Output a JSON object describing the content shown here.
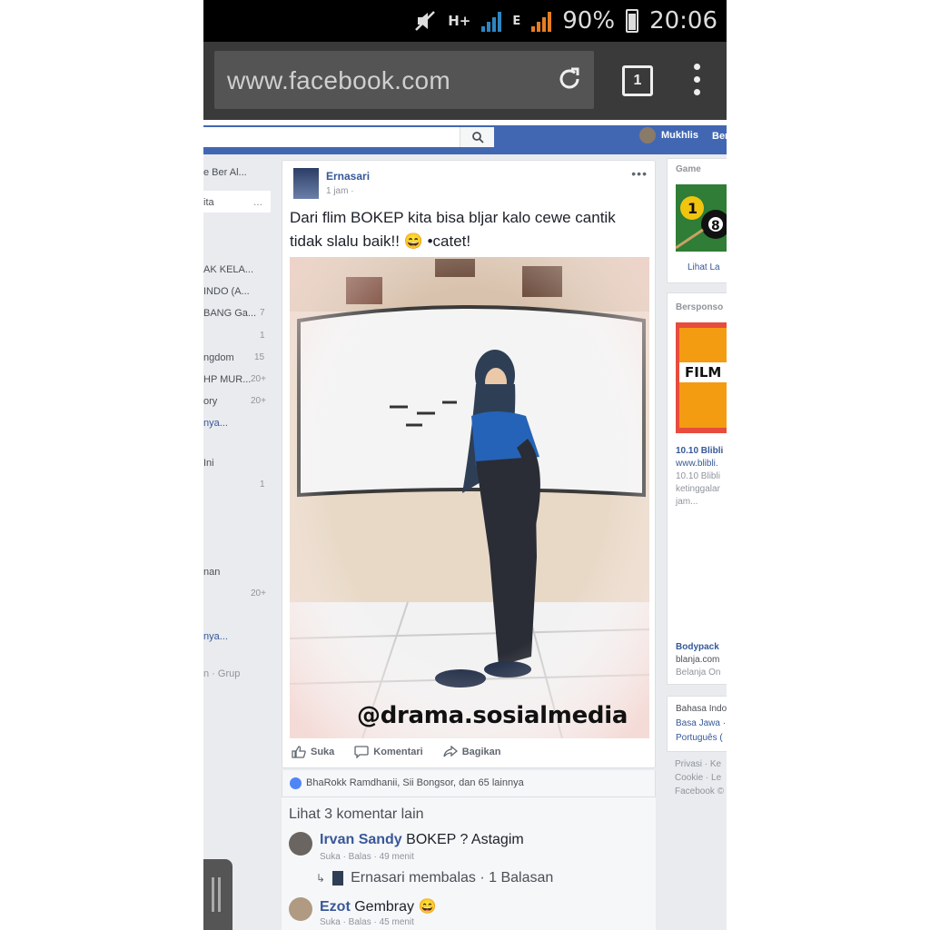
{
  "status_bar": {
    "network_type": "H+",
    "network_type2": "E",
    "battery": "90%",
    "time": "20:06"
  },
  "browser": {
    "url": "www.facebook.com",
    "tab_count": "1"
  },
  "fb_header": {
    "user_name": "Mukhlis",
    "user_extra": "Ber"
  },
  "left_nav": {
    "items": [
      {
        "label": "e Ber Al...",
        "count": ""
      },
      {
        "label": "ita",
        "count": "..."
      },
      {
        "label": "AK KELA...",
        "count": ""
      },
      {
        "label": "INDO (A...",
        "count": ""
      },
      {
        "label": "BANG Ga...",
        "count": "7"
      },
      {
        "label": "",
        "count": "1"
      },
      {
        "label": "ngdom",
        "count": "15"
      },
      {
        "label": "HP MUR...",
        "count": "20+"
      },
      {
        "label": "ory",
        "count": "20+"
      },
      {
        "label": "nya...",
        "count": ""
      },
      {
        "label": "Ini",
        "count": ""
      },
      {
        "label": "",
        "count": "1"
      },
      {
        "label": "nan",
        "count": ""
      },
      {
        "label": "",
        "count": "20+"
      },
      {
        "label": "nya...",
        "count": ""
      },
      {
        "label": "n · Grup",
        "count": ""
      }
    ]
  },
  "post": {
    "author": "Ernasari",
    "time": "1 jam ·",
    "text": "Dari flim BOKEP kita bisa bljar kalo cewe cantik tidak slalu baik!! 😄 •catet!",
    "watermark": "@drama.sosialmedia",
    "actions": {
      "like": "Suka",
      "comment": "Komentari",
      "share": "Bagikan"
    },
    "likes_text": "BhaRokk Ramdhanii, Sii Bongsor, dan 65 lainnya"
  },
  "comments": {
    "more_label": "Lihat 3 komentar lain",
    "items": [
      {
        "name": "Irvan Sandy",
        "text": "BOKEP ? Astagim",
        "meta": "Suka · Balas · 49 menit"
      },
      {
        "name": "Ezot",
        "text": "Gembray 😄",
        "meta": "Suka · Balas · 45 menit"
      }
    ],
    "reply_text": "Ernasari membalas · 1 Balasan"
  },
  "right_column": {
    "game_label": "Game",
    "game_see_more": "Lihat La",
    "sponsored_label": "Bersponso",
    "ad1_title": "10.10 Blibli",
    "ad1_url": "www.blibli.",
    "ad1_desc1": "10.10 Blibli",
    "ad1_desc2": "ketinggalar",
    "ad1_desc3": "jam...",
    "ad1_image_text": "FILM",
    "ad2_title": "Bodypack",
    "ad2_url": "blanja.com",
    "ad2_desc": "Belanja On",
    "lang1": "Bahasa Indo",
    "lang2": "Basa Jawa ·",
    "lang3": "Português (",
    "footer1": "Privasi · Ke",
    "footer2": "Cookie · Le",
    "footer3": "Facebook ©"
  },
  "colors": {
    "fb_blue": "#4267b2",
    "link_blue": "#365899",
    "status_signal_blue": "#2e86c1",
    "status_signal_orange": "#e67e22"
  }
}
